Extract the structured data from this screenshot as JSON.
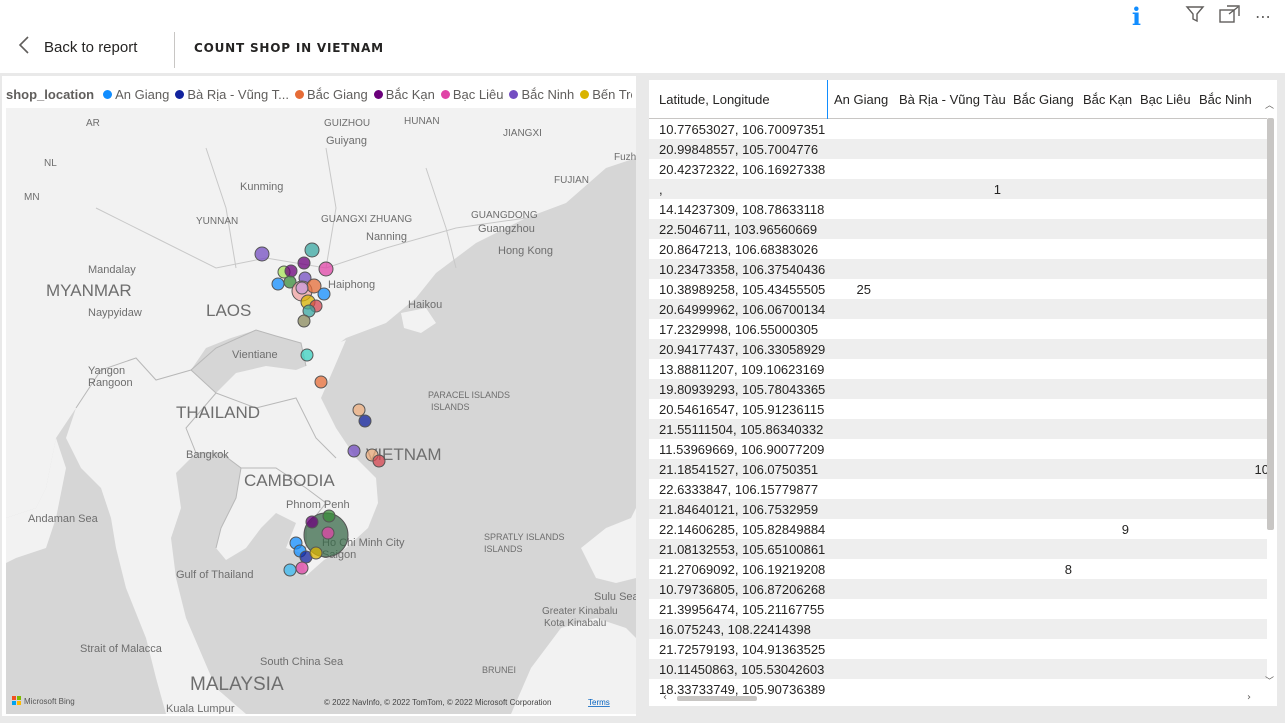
{
  "header": {
    "back_label": "Back to report",
    "page_title": "COUNT SHOP IN VIETNAM"
  },
  "top_icons": [
    "info-icon",
    "filter-icon",
    "focus-mode-icon",
    "more-options-icon"
  ],
  "map_visual": {
    "legend_title": "shop_location",
    "legend_items": [
      {
        "label": "An Giang",
        "color": "#118dff"
      },
      {
        "label": "Bà Rịa - Vũng T...",
        "color": "#12239e"
      },
      {
        "label": "Bắc Giang",
        "color": "#e66c37"
      },
      {
        "label": "Bắc Kạn",
        "color": "#6b007b"
      },
      {
        "label": "Bạc Liêu",
        "color": "#e044a7"
      },
      {
        "label": "Bắc Ninh",
        "color": "#744ec2"
      },
      {
        "label": "Bến Tre",
        "color": "#d9b300"
      }
    ],
    "map_labels": {
      "countries": [
        "MYANMAR",
        "LAOS",
        "THAILAND",
        "CAMBODIA",
        "MALAYSIA",
        "VIETNAM"
      ],
      "regions": [
        "YUNNAN",
        "GUANGXI ZHUANG",
        "GUANGDONG",
        "GUIZHOU",
        "HUNAN",
        "JIANGXI",
        "FUJIAN",
        "PARACEL ISLANDS",
        "SPRATLY ISLANDS",
        "BRUNEI",
        "AR",
        "NL",
        "MN",
        "Fuzh"
      ],
      "cities": [
        "Guiyang",
        "Kunming",
        "Nanning",
        "Guangzhou",
        "Hong Kong",
        "Haiphong",
        "Haikou",
        "Mandalay",
        "Naypyidaw",
        "Vientiane",
        "Yangon",
        "Rangoon",
        "Bangkok",
        "Phnom Penh",
        "Ho Chi Minh City",
        "Saigon",
        "Kota Kinabalu",
        "Kuala Lumpur"
      ],
      "waters": [
        "Andaman Sea",
        "Gulf of Thailand",
        "Strait of Malacca",
        "South China Sea",
        "Sulu Sea"
      ],
      "other": [
        "Greater Kinabalu",
        "Kota",
        "Kinabalu"
      ]
    },
    "bing_logo": "Microsoft Bing",
    "attribution": "© 2022 NavInfo, © 2022 TomTom, © 2022 Microsoft Corporation",
    "terms_link": "Terms"
  },
  "table_visual": {
    "columns": [
      "Latitude, Longitude",
      "An Giang",
      "Bà Rịa - Vũng Tàu",
      "Bắc Giang",
      "Bắc Kạn",
      "Bạc Liêu",
      "Bắc Ninh"
    ],
    "rows": [
      {
        "key": "10.77653027, 106.70097351",
        "values": [
          "",
          "",
          "",
          "",
          "",
          ""
        ]
      },
      {
        "key": "20.99848557, 105.7004776",
        "values": [
          "",
          "",
          "",
          "",
          "",
          ""
        ]
      },
      {
        "key": "20.42372322, 106.16927338",
        "values": [
          "",
          "",
          "",
          "",
          "",
          ""
        ]
      },
      {
        "key": ",",
        "values": [
          "",
          "1",
          "",
          "",
          "",
          ""
        ]
      },
      {
        "key": "14.14237309, 108.78633118",
        "values": [
          "",
          "",
          "",
          "",
          "",
          ""
        ]
      },
      {
        "key": "22.5046711, 103.96560669",
        "values": [
          "",
          "",
          "",
          "",
          "",
          ""
        ]
      },
      {
        "key": "20.8647213, 106.68383026",
        "values": [
          "",
          "",
          "",
          "",
          "",
          ""
        ]
      },
      {
        "key": "10.23473358, 106.37540436",
        "values": [
          "",
          "",
          "",
          "",
          "",
          ""
        ]
      },
      {
        "key": "10.38989258, 105.43455505",
        "values": [
          "25",
          "",
          "",
          "",
          "",
          ""
        ]
      },
      {
        "key": "20.64999962, 106.06700134",
        "values": [
          "",
          "",
          "",
          "",
          "",
          ""
        ]
      },
      {
        "key": "17.2329998, 106.55000305",
        "values": [
          "",
          "",
          "",
          "",
          "",
          ""
        ]
      },
      {
        "key": "20.94177437, 106.33058929",
        "values": [
          "",
          "",
          "",
          "",
          "",
          ""
        ]
      },
      {
        "key": "13.88811207, 109.10623169",
        "values": [
          "",
          "",
          "",
          "",
          "",
          ""
        ]
      },
      {
        "key": "19.80939293, 105.78043365",
        "values": [
          "",
          "",
          "",
          "",
          "",
          ""
        ]
      },
      {
        "key": "20.54616547, 105.91236115",
        "values": [
          "",
          "",
          "",
          "",
          "",
          ""
        ]
      },
      {
        "key": "21.55111504, 105.86340332",
        "values": [
          "",
          "",
          "",
          "",
          "",
          ""
        ]
      },
      {
        "key": "11.53969669, 106.90077209",
        "values": [
          "",
          "",
          "",
          "",
          "",
          ""
        ]
      },
      {
        "key": "21.18541527, 106.0750351",
        "values": [
          "",
          "",
          "",
          "",
          "",
          "10"
        ]
      },
      {
        "key": "22.6333847, 106.15779877",
        "values": [
          "",
          "",
          "",
          "",
          "",
          ""
        ]
      },
      {
        "key": "21.84640121, 106.7532959",
        "values": [
          "",
          "",
          "",
          "",
          "",
          ""
        ]
      },
      {
        "key": "22.14606285, 105.82849884",
        "values": [
          "",
          "",
          "",
          "9",
          "",
          ""
        ]
      },
      {
        "key": "21.08132553, 105.65100861",
        "values": [
          "",
          "",
          "",
          "",
          "",
          ""
        ]
      },
      {
        "key": "21.27069092, 106.19219208",
        "values": [
          "",
          "",
          "8",
          "",
          "",
          ""
        ]
      },
      {
        "key": "10.79736805, 106.87206268",
        "values": [
          "",
          "",
          "",
          "",
          "",
          ""
        ]
      },
      {
        "key": "21.39956474, 105.21167755",
        "values": [
          "",
          "",
          "",
          "",
          "",
          ""
        ]
      },
      {
        "key": "16.075243, 108.22414398",
        "values": [
          "",
          "",
          "",
          "",
          "",
          ""
        ]
      },
      {
        "key": "21.72579193, 104.91363525",
        "values": [
          "",
          "",
          "",
          "",
          "",
          ""
        ]
      },
      {
        "key": "10.11450863, 105.53042603",
        "values": [
          "",
          "",
          "",
          "",
          "",
          ""
        ]
      },
      {
        "key": "18.33733749, 105.90736389",
        "values": [
          "",
          "",
          "",
          "",
          "",
          ""
        ]
      }
    ]
  }
}
